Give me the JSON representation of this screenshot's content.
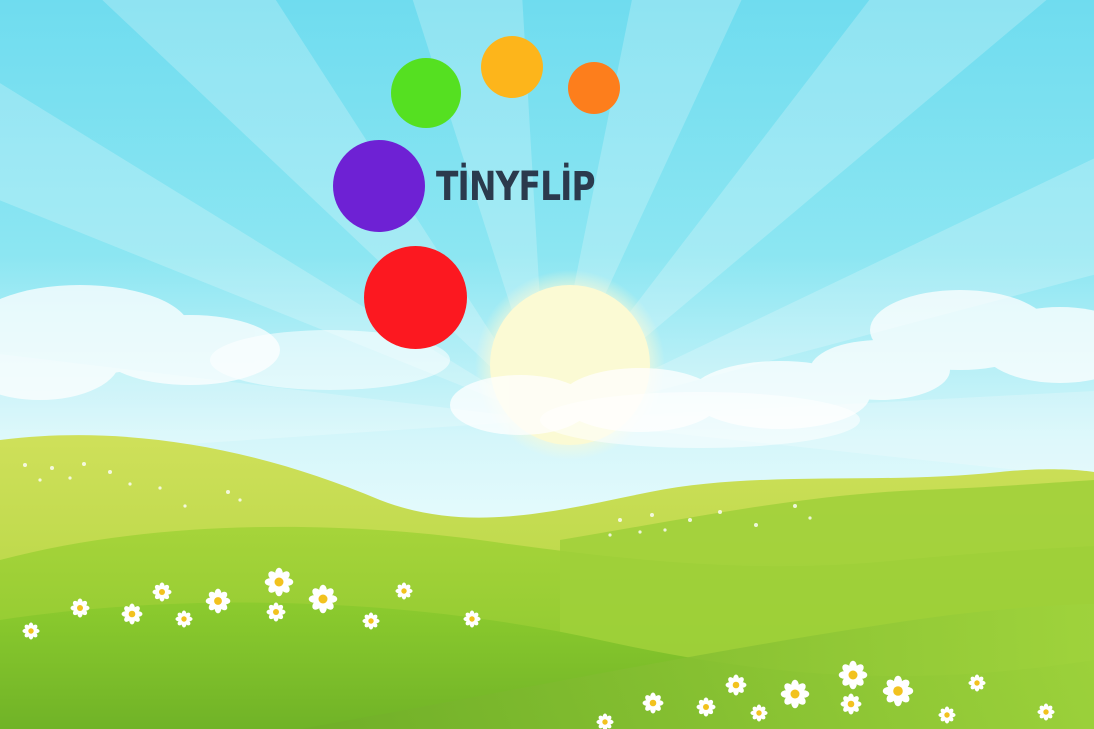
{
  "logo": {
    "text": "TİNYFLİP",
    "text_color": "#2b3a4d",
    "dot_colors": {
      "green": "#55e021",
      "yellow": "#fdb51b",
      "orange": "#fd7e1c",
      "purple": "#6e21d4",
      "red": "#fc1820"
    }
  },
  "scene": {
    "sky_top": "#6fdbee",
    "sky_horizon": "#e6fbfd",
    "sun": "#fbfbdc",
    "hill_far": "#c7dc50",
    "hill_mid": "#95cd2e",
    "hill_near": "#7ebf2a",
    "flower_petal": "#ffffff",
    "flower_center": "#f3c623"
  }
}
